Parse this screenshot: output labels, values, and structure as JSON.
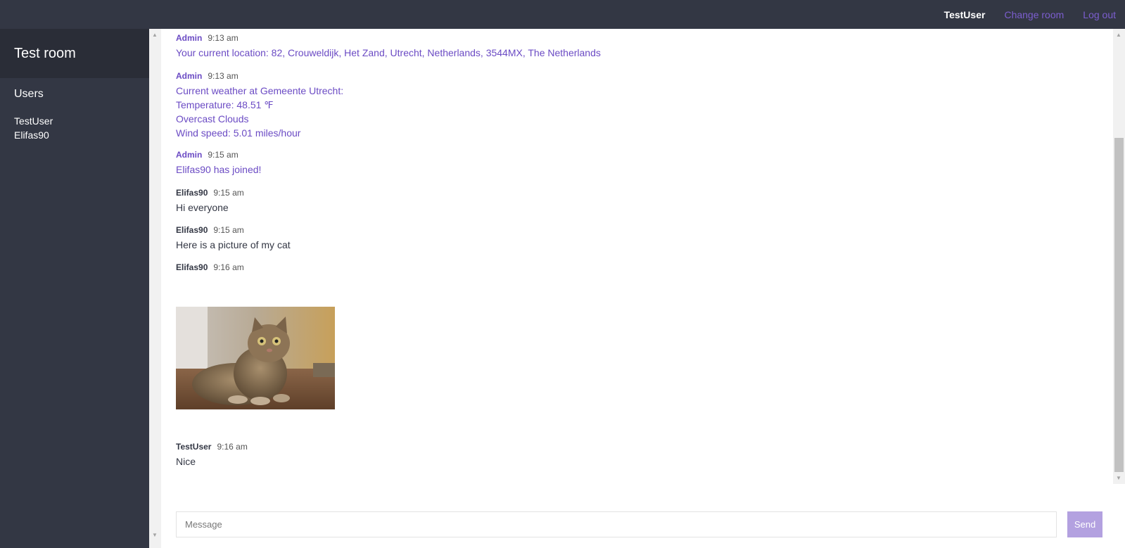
{
  "header": {
    "current_user": "TestUser",
    "change_room_label": "Change room",
    "logout_label": "Log out"
  },
  "sidebar": {
    "room_name": "Test room",
    "users_title": "Users",
    "users": [
      "TestUser",
      "Elifas90"
    ]
  },
  "messages": [
    {
      "author": "Admin",
      "time": "9:13 am",
      "lines": [
        "Your current location: 82, Crouweldijk, Het Zand, Utrecht, Netherlands, 3544MX, The Netherlands"
      ]
    },
    {
      "author": "Admin",
      "time": "9:13 am",
      "lines": [
        "Current weather at Gemeente Utrecht:",
        "Temperature: 48.51 ℉",
        "Overcast Clouds",
        "Wind speed: 5.01 miles/hour"
      ]
    },
    {
      "author": "Admin",
      "time": "9:15 am",
      "lines": [
        "Elifas90 has joined!"
      ]
    },
    {
      "author": "Elifas90",
      "time": "9:15 am",
      "lines": [
        "Hi everyone"
      ]
    },
    {
      "author": "Elifas90",
      "time": "9:15 am",
      "lines": [
        "Here is a picture of my cat"
      ]
    },
    {
      "author": "Elifas90",
      "time": "9:16 am",
      "lines": []
    },
    {
      "author": "TestUser",
      "time": "9:16 am",
      "lines": [
        "Nice"
      ]
    }
  ],
  "composer": {
    "placeholder": "Message",
    "send_label": "Send"
  },
  "colors": {
    "dark": "#333744",
    "accent": "#6b4bc4",
    "send_button": "#b3a1e0"
  }
}
